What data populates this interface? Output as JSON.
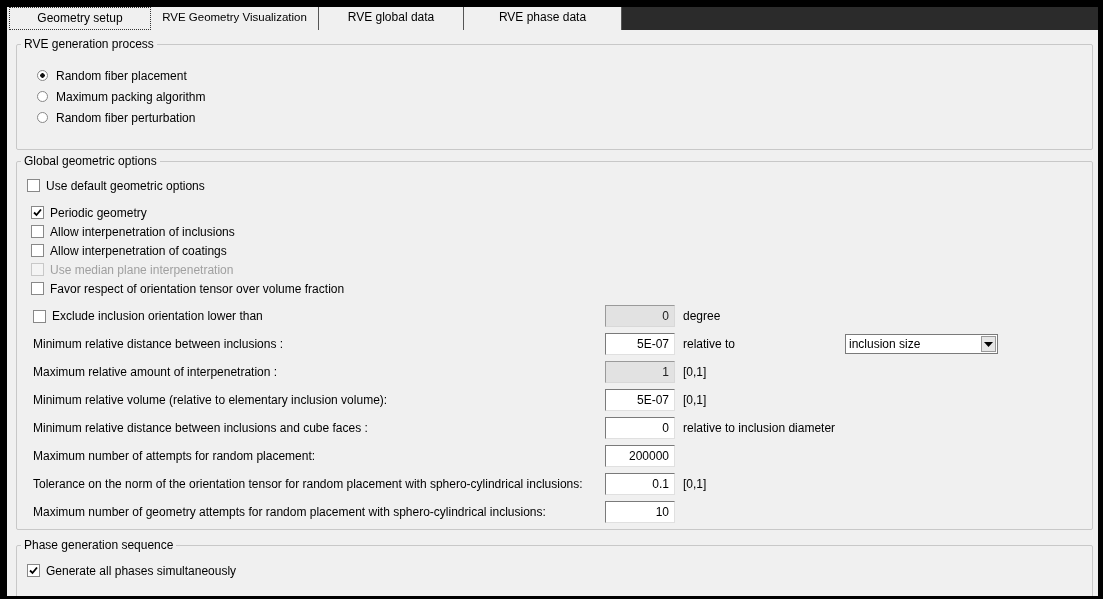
{
  "tabs": [
    {
      "label": "Geometry setup",
      "selected": true
    },
    {
      "label": "RVE Geometry Visualization",
      "selected": false
    },
    {
      "label": "RVE global data",
      "selected": false
    },
    {
      "label": "RVE phase data",
      "selected": false
    }
  ],
  "generation_process": {
    "title": "RVE generation process",
    "options": [
      {
        "label": "Random fiber placement",
        "selected": true
      },
      {
        "label": "Maximum packing algorithm",
        "selected": false
      },
      {
        "label": "Random fiber perturbation",
        "selected": false
      }
    ]
  },
  "global_options": {
    "title": "Global geometric options",
    "default_option": {
      "label": "Use default geometric options",
      "checked": false
    },
    "checkboxes": [
      {
        "label": "Periodic geometry",
        "checked": true,
        "disabled": false
      },
      {
        "label": "Allow interpenetration of inclusions",
        "checked": false,
        "disabled": false
      },
      {
        "label": "Allow interpenetration of coatings",
        "checked": false,
        "disabled": false
      },
      {
        "label": "Use median plane interpenetration",
        "checked": false,
        "disabled": true
      },
      {
        "label": "Favor respect of orientation tensor over volume fraction",
        "checked": false,
        "disabled": false
      }
    ],
    "parameters": [
      {
        "kind": "checkbox",
        "label": "Exclude inclusion orientation lower than",
        "checked": false,
        "value": "0",
        "disabled": true,
        "unit": "degree"
      },
      {
        "kind": "text",
        "label": "Minimum relative distance between inclusions :",
        "value": "5E-07",
        "disabled": false,
        "unit": "relative to",
        "select": {
          "value": "inclusion size"
        }
      },
      {
        "kind": "text",
        "label": "Maximum relative amount of interpenetration :",
        "value": "1",
        "disabled": true,
        "unit": "[0,1]"
      },
      {
        "kind": "text",
        "label": "Minimum relative volume (relative to elementary inclusion volume):",
        "value": "5E-07",
        "disabled": false,
        "unit": "[0,1]"
      },
      {
        "kind": "text",
        "label": "Minimum relative distance between inclusions and cube faces :",
        "value": "0",
        "disabled": false,
        "unit": "relative to inclusion diameter"
      },
      {
        "kind": "text",
        "label": "Maximum number of attempts for random placement:",
        "value": "200000",
        "disabled": false
      },
      {
        "kind": "text",
        "label": "Tolerance on the norm of the orientation tensor for random placement with sphero-cylindrical inclusions:",
        "value": "0.1",
        "disabled": false,
        "unit": "[0,1]"
      },
      {
        "kind": "text",
        "label": "Maximum number of geometry attempts for random placement with sphero-cylindrical inclusions:",
        "value": "10",
        "disabled": false
      }
    ]
  },
  "phase_sequence": {
    "title": "Phase generation sequence",
    "checkboxes": [
      {
        "label": "Generate all phases simultaneously",
        "checked": true,
        "disabled": false
      }
    ]
  }
}
